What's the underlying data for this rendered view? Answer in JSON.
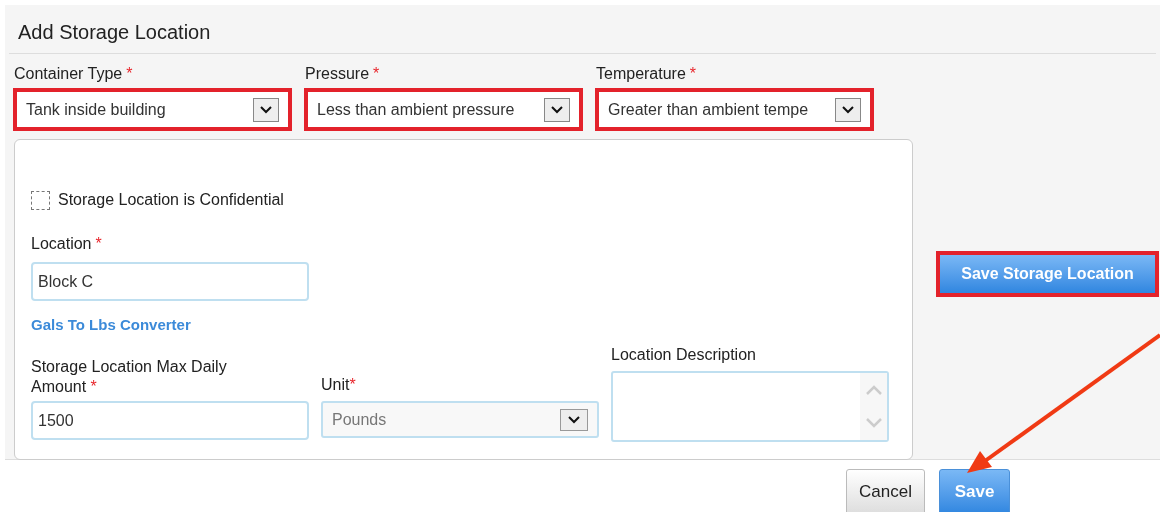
{
  "title": "Add Storage Location",
  "selects": [
    {
      "label": "Container Type",
      "required_mark": "*",
      "value": "Tank inside building",
      "highlighted": true
    },
    {
      "label": "Pressure",
      "required_mark": "*",
      "value": "Less than ambient pressure",
      "highlighted": true
    },
    {
      "label": "Temperature",
      "required_mark": "*",
      "value": "Greater than ambient tempe",
      "highlighted": true
    }
  ],
  "confidential": {
    "label": "Storage Location is Confidential",
    "checked": false
  },
  "location": {
    "label": "Location",
    "required_mark": "*",
    "value": "Block C"
  },
  "converter_link": "Gals To Lbs Converter",
  "max_daily": {
    "label": "Storage Location Max Daily Amount",
    "required_mark": "*",
    "value": "1500"
  },
  "unit": {
    "label": "Unit",
    "required_mark": "*",
    "value": "Pounds"
  },
  "description": {
    "label": "Location Description"
  },
  "save_location_button": {
    "label": "Save Storage Location",
    "highlighted": true
  },
  "footer_buttons": [
    {
      "label": "Cancel",
      "kind": "secondary"
    },
    {
      "label": "Save",
      "kind": "primary"
    }
  ]
}
